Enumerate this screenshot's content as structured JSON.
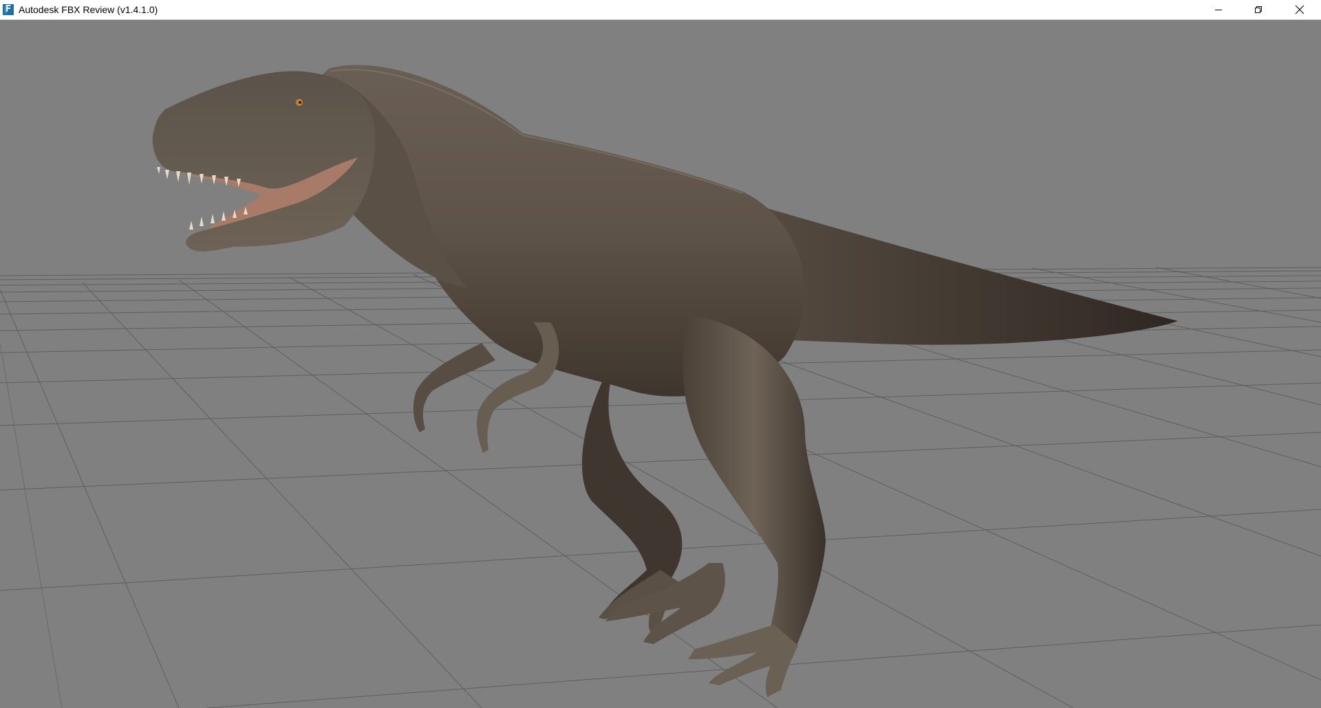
{
  "window": {
    "title": "Autodesk FBX Review (v1.4.1.0)",
    "app_icon": "fbx-review-icon",
    "controls": [
      "minimize-icon",
      "restore-icon",
      "close-icon"
    ]
  },
  "viewport": {
    "background_color": "#808080",
    "grid_color": "#5e5e5e",
    "model": "tyrannosaurus-rex",
    "model_colors": {
      "body": "#5e5348",
      "shadow": "#2f2822",
      "highlight": "#8a7f72",
      "mouth": "#a87a68",
      "teeth": "#e6dcc6",
      "eye": "#c8822a"
    }
  }
}
